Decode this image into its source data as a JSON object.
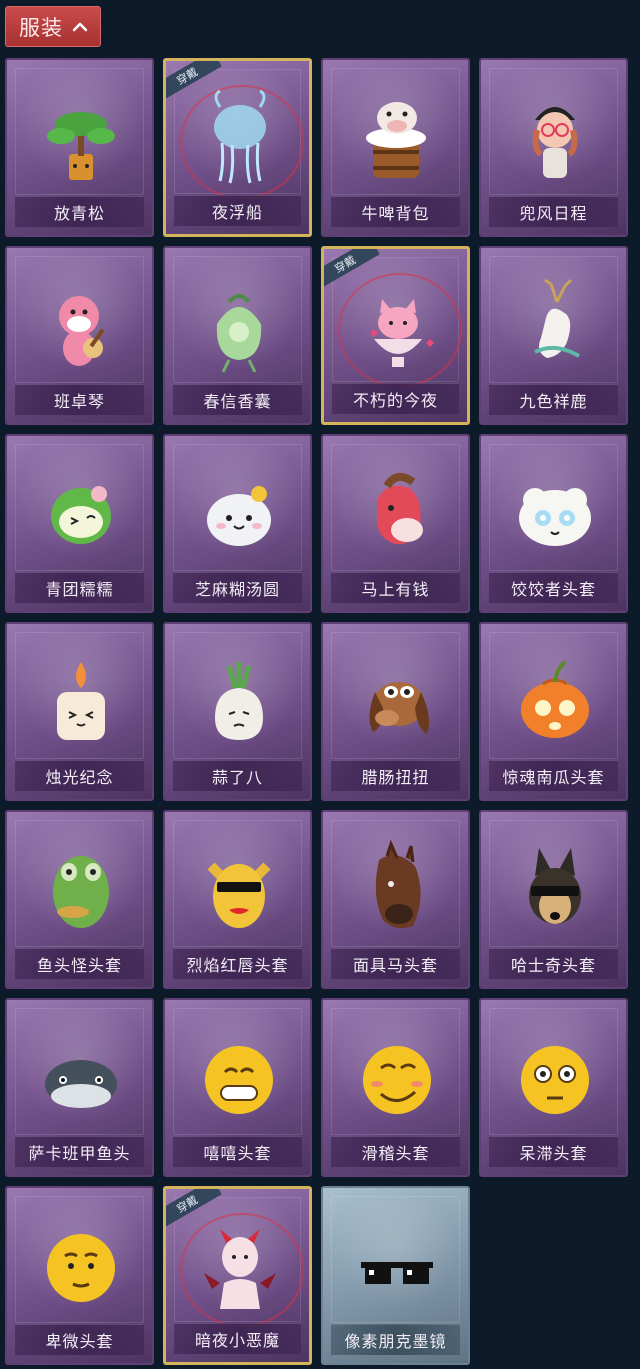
{
  "header": {
    "label": "服装",
    "icon": "chevron-up-icon"
  },
  "worn_label": "穿戴",
  "items": [
    {
      "name": "放青松",
      "art": "bonsai-pine",
      "worn": false
    },
    {
      "name": "夜浮船",
      "art": "jellyfish",
      "worn": true
    },
    {
      "name": "牛啤背包",
      "art": "cow-beer-mug",
      "worn": false
    },
    {
      "name": "兜风日程",
      "art": "pink-girl-cap",
      "worn": false
    },
    {
      "name": "班卓琴",
      "art": "pink-beaver-banjo",
      "worn": false
    },
    {
      "name": "春信香囊",
      "art": "green-sachet",
      "worn": false
    },
    {
      "name": "不朽的今夜",
      "art": "pink-fox-bowl",
      "worn": true
    },
    {
      "name": "九色祥鹿",
      "art": "white-deer",
      "worn": false
    },
    {
      "name": "青团糯糯",
      "art": "green-mochi",
      "worn": false
    },
    {
      "name": "芝麻糊汤圆",
      "art": "white-dumpling",
      "worn": false
    },
    {
      "name": "马上有钱",
      "art": "red-horse",
      "worn": false
    },
    {
      "name": "饺饺者头套",
      "art": "dumpling-head",
      "worn": false
    },
    {
      "name": "烛光纪念",
      "art": "candle",
      "worn": false
    },
    {
      "name": "蒜了八",
      "art": "garlic",
      "worn": false
    },
    {
      "name": "腊肠扭扭",
      "art": "dachshund",
      "worn": false
    },
    {
      "name": "惊魂南瓜头套",
      "art": "pumpkin",
      "worn": false
    },
    {
      "name": "鱼头怪头套",
      "art": "fish-head",
      "worn": false
    },
    {
      "name": "烈焰红唇头套",
      "art": "yellow-mask",
      "worn": false
    },
    {
      "name": "面具马头套",
      "art": "horse-mask",
      "worn": false
    },
    {
      "name": "哈士奇头套",
      "art": "husky",
      "worn": false
    },
    {
      "name": "萨卡班甲鱼头",
      "art": "whale-fish",
      "worn": false
    },
    {
      "name": "嘻嘻头套",
      "art": "grin-emoji",
      "worn": false
    },
    {
      "name": "滑稽头套",
      "art": "smirk-emoji",
      "worn": false
    },
    {
      "name": "呆滞头套",
      "art": "blank-emoji",
      "worn": false
    },
    {
      "name": "卑微头套",
      "art": "shy-emoji",
      "worn": false
    },
    {
      "name": "暗夜小恶魔",
      "art": "little-devil",
      "worn": true
    },
    {
      "name": "像素朋克墨镜",
      "art": "pixel-sunglasses",
      "worn": false
    }
  ],
  "colors": {
    "background": "#0d1a2a",
    "header": "#b73a3a",
    "card": "#7a5a94",
    "worn_border": "#d4b45a"
  }
}
